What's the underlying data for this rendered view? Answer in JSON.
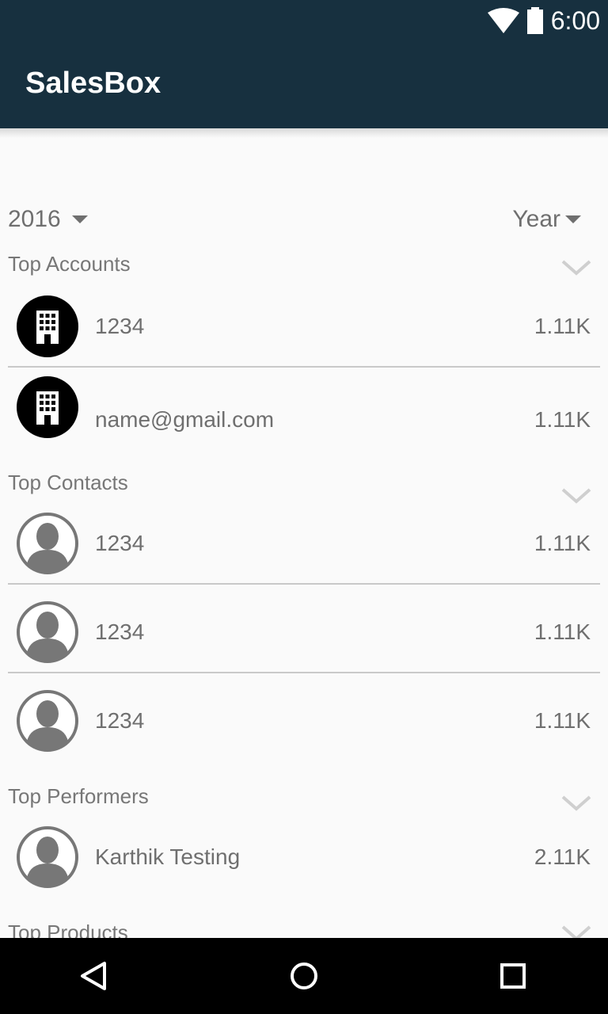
{
  "status_bar": {
    "time": "6:00"
  },
  "app_bar": {
    "title": "SalesBox"
  },
  "filters": {
    "year": "2016",
    "period": "Year"
  },
  "sections": {
    "accounts": {
      "title": "Top Accounts",
      "items": [
        {
          "name": "1234",
          "value": "1.11K"
        },
        {
          "name": "name@gmail.com",
          "value": "1.11K"
        }
      ]
    },
    "contacts": {
      "title": "Top Contacts",
      "items": [
        {
          "name": "1234",
          "value": "1.11K"
        },
        {
          "name": "1234",
          "value": "1.11K"
        },
        {
          "name": "1234",
          "value": "1.11K"
        }
      ]
    },
    "performers": {
      "title": "Top Performers",
      "items": [
        {
          "name": "Karthik Testing",
          "value": "2.11K"
        }
      ]
    },
    "products": {
      "title": "Top Products"
    }
  },
  "icons": {
    "account_avatar": "building-icon",
    "contact_avatar": "person-icon",
    "collapse": "chevron-down-icon",
    "nav_back": "back-icon",
    "nav_home": "home-icon",
    "nav_recents": "recents-icon"
  }
}
